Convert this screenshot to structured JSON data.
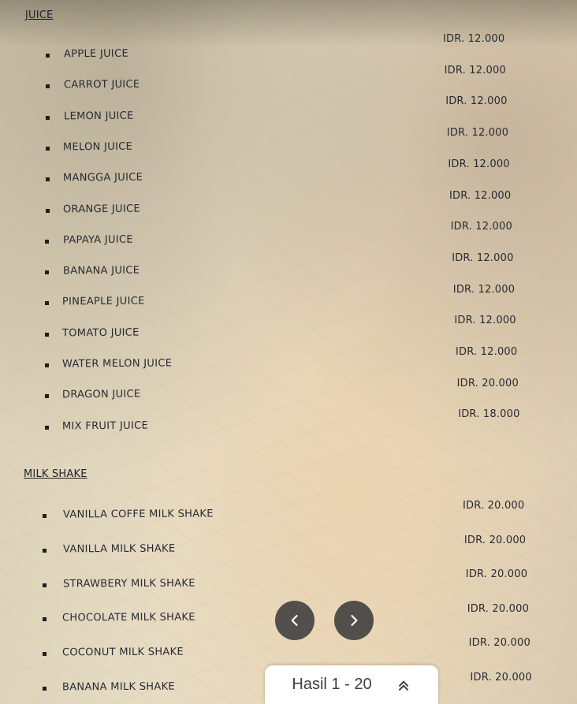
{
  "sections": [
    {
      "title": "JUICE",
      "items": [
        {
          "name": "APPLE JUICE",
          "price": "IDR. 12.000"
        },
        {
          "name": "CARROT JUICE",
          "price": "IDR. 12.000"
        },
        {
          "name": "LEMON JUICE",
          "price": "IDR. 12.000"
        },
        {
          "name": "MELON JUICE",
          "price": "IDR. 12.000"
        },
        {
          "name": "MANGGA JUICE",
          "price": "IDR. 12.000"
        },
        {
          "name": "ORANGE JUICE",
          "price": "IDR. 12.000"
        },
        {
          "name": "PAPAYA JUICE",
          "price": "IDR. 12.000"
        },
        {
          "name": "BANANA JUICE",
          "price": "IDR. 12.000"
        },
        {
          "name": "PINEAPLE JUICE",
          "price": "IDR. 12.000"
        },
        {
          "name": "TOMATO JUICE",
          "price": "IDR. 12.000"
        },
        {
          "name": "WATER MELON JUICE",
          "price": "IDR. 12.000"
        },
        {
          "name": "DRAGON JUICE",
          "price": "IDR. 20.000"
        },
        {
          "name": "MIX FRUIT JUICE",
          "price": "IDR. 18.000"
        }
      ]
    },
    {
      "title": "MILK SHAKE",
      "items": [
        {
          "name": "VANILLA COFFE MILK SHAKE",
          "price": "IDR. 20.000"
        },
        {
          "name": "VANILLA MILK SHAKE",
          "price": "IDR. 20.000"
        },
        {
          "name": "STRAWBERY MILK SHAKE",
          "price": "IDR. 20.000"
        },
        {
          "name": "CHOCOLATE MILK SHAKE",
          "price": "IDR. 20.000"
        },
        {
          "name": "COCONUT MILK SHAKE",
          "price": "IDR. 20.000"
        },
        {
          "name": "BANANA MILK SHAKE",
          "price": "IDR. 20.000"
        }
      ]
    }
  ],
  "viewer": {
    "prev_icon": "chevron-left-icon",
    "next_icon": "chevron-right-icon",
    "collapse_icon": "double-chevron-up-icon",
    "results_label": "Hasil 1 - 20"
  }
}
